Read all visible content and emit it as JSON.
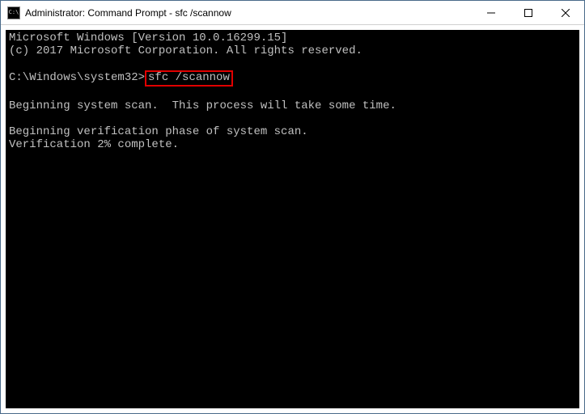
{
  "titlebar": {
    "icon_label": "C:\\",
    "title": "Administrator: Command Prompt - sfc  /scannow"
  },
  "terminal": {
    "line1": "Microsoft Windows [Version 10.0.16299.15]",
    "line2": "(c) 2017 Microsoft Corporation. All rights reserved.",
    "blank1": "",
    "prompt": "C:\\Windows\\system32>",
    "command": "sfc /scannow",
    "blank2": "",
    "scan_start": "Beginning system scan.  This process will take some time.",
    "blank3": "",
    "verify_phase": "Beginning verification phase of system scan.",
    "verify_progress": "Verification 2% complete."
  }
}
